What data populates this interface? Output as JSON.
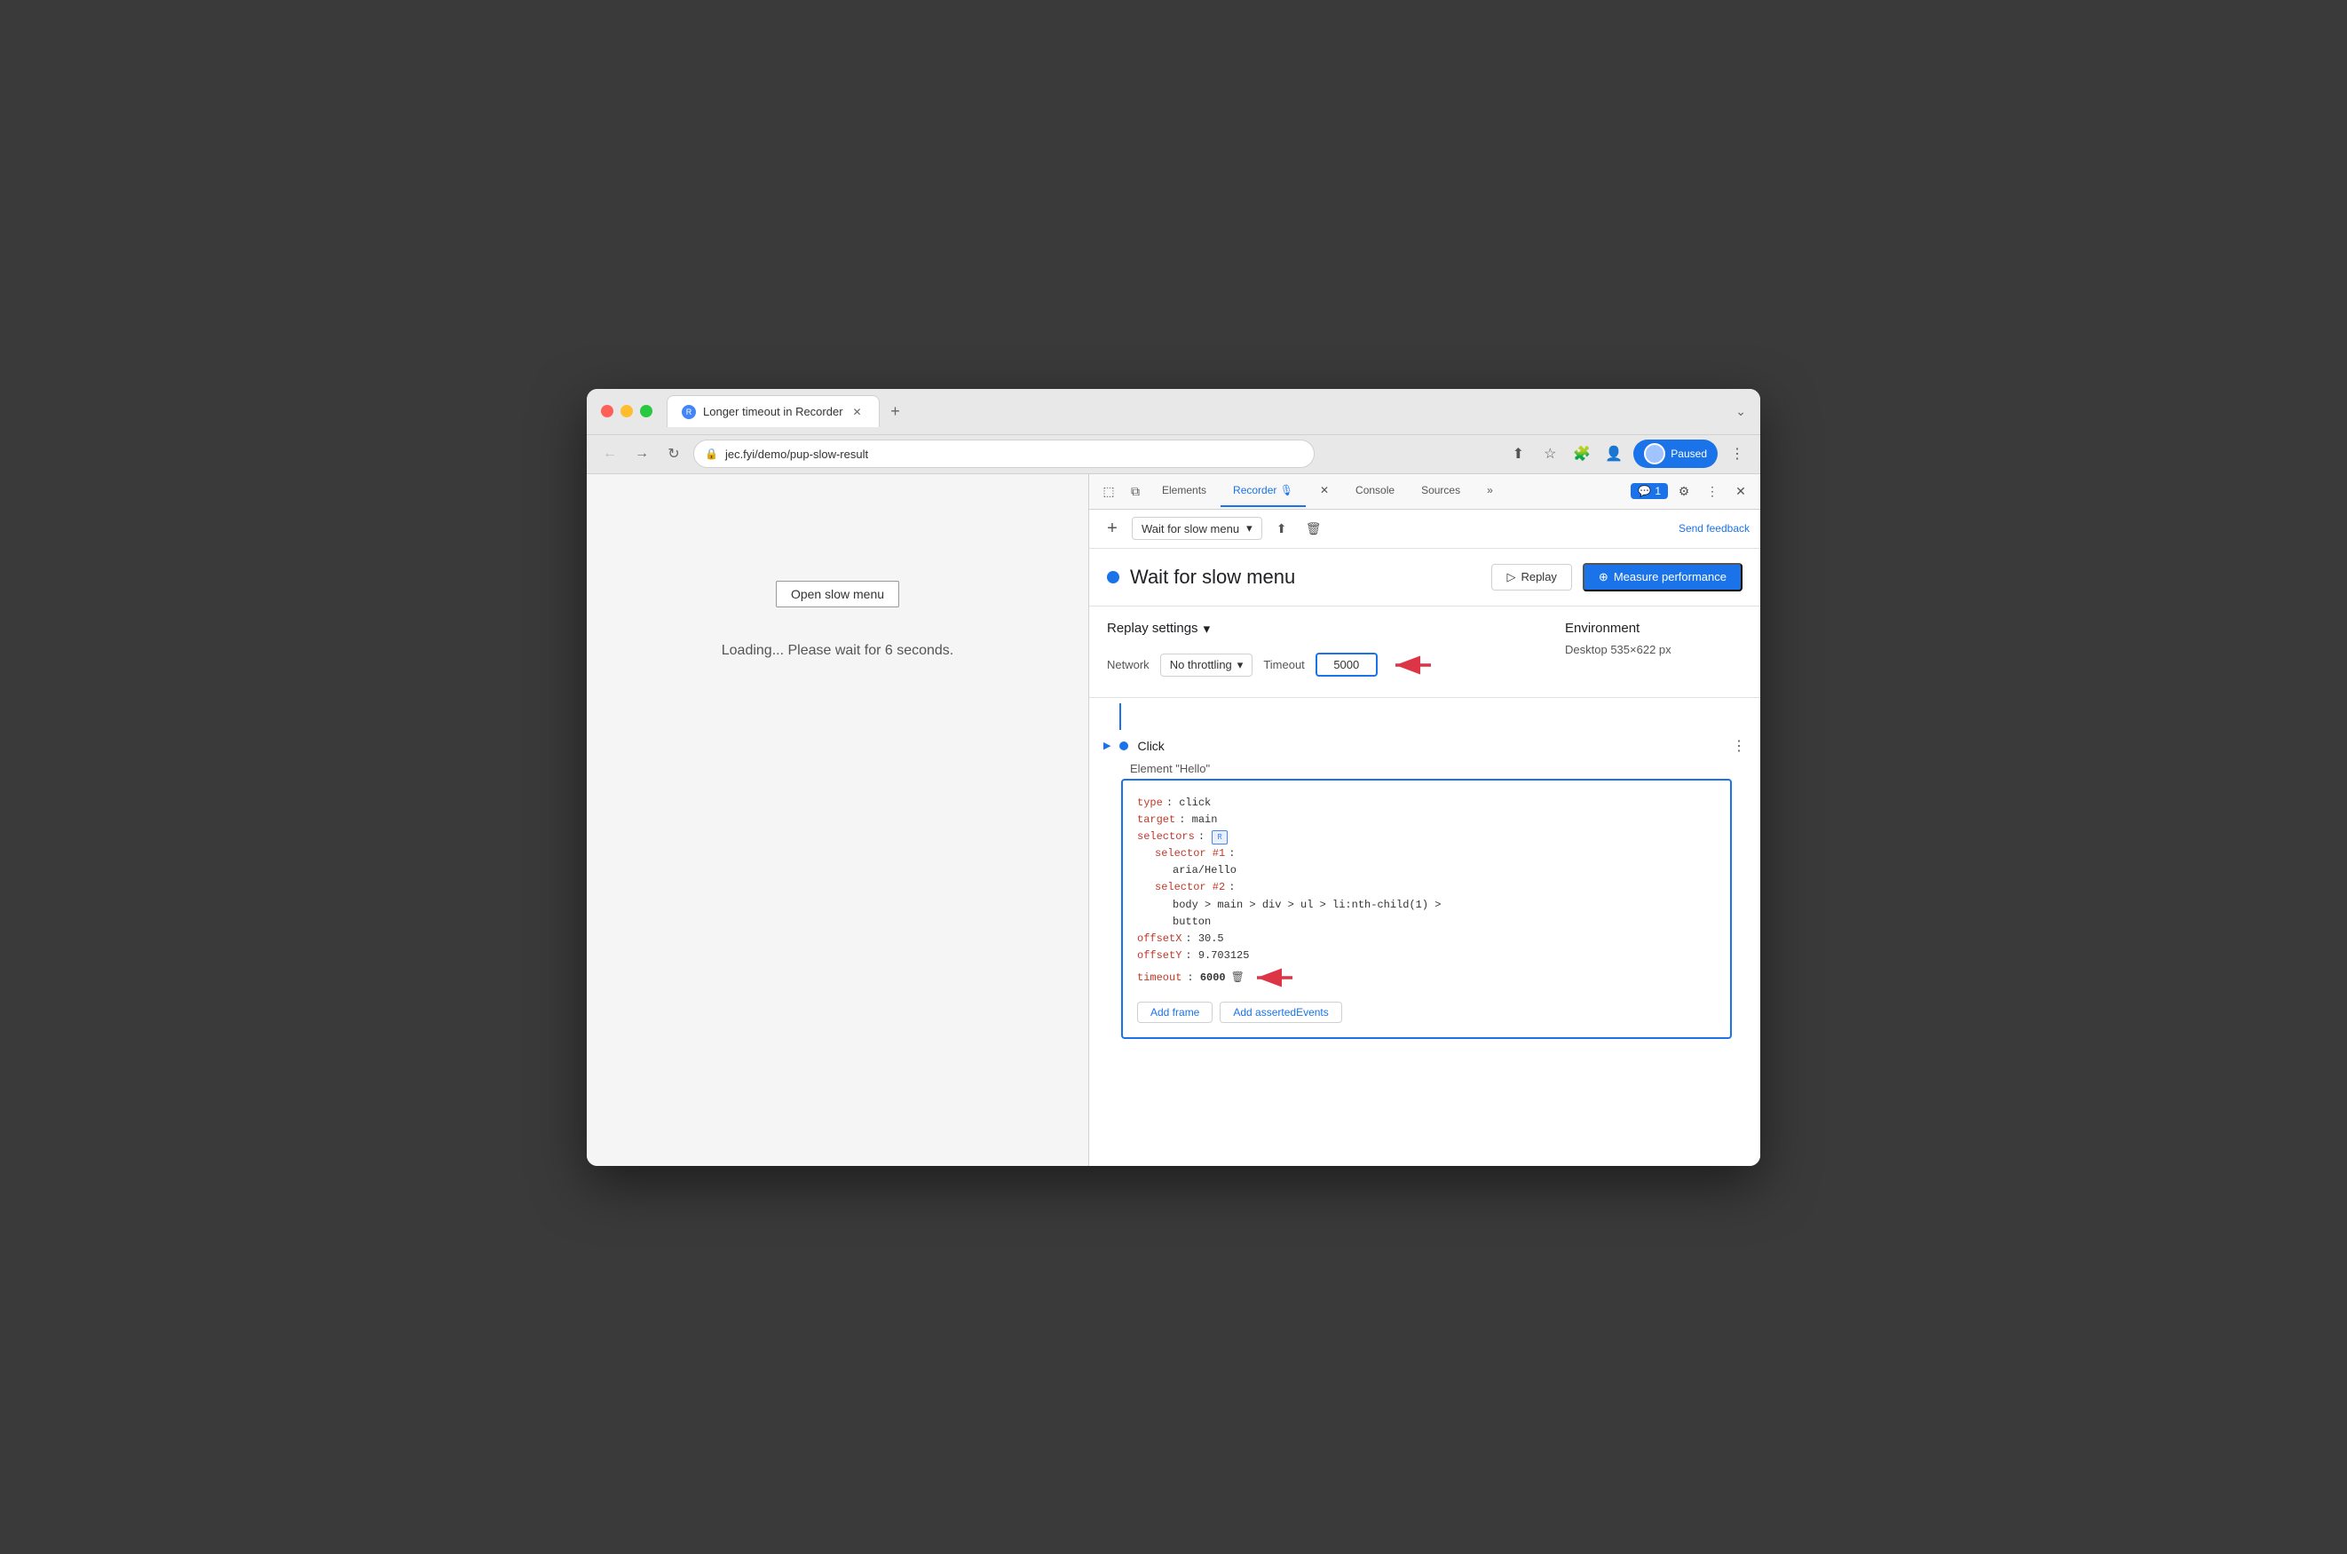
{
  "browser": {
    "tab_title": "Longer timeout in Recorder",
    "url": "jec.fyi/demo/pup-slow-result",
    "paused_label": "Paused"
  },
  "devtools": {
    "tabs": [
      "Elements",
      "Recorder",
      "Console",
      "Sources"
    ],
    "active_tab": "Recorder",
    "more_label": "»",
    "notification_count": "1",
    "send_feedback": "Send feedback"
  },
  "recorder": {
    "add_label": "+",
    "recording_name": "Wait for slow menu",
    "replay_label": "Replay",
    "measure_label": "Measure performance",
    "recording_title": "Wait for slow menu",
    "settings_title": "Replay settings",
    "network_label": "Network",
    "network_value": "No throttling",
    "timeout_label": "Timeout",
    "timeout_value": "5000",
    "env_title": "Environment",
    "env_value": "Desktop",
    "env_size": "535×622 px"
  },
  "step": {
    "name": "Click",
    "sub_label": "Element \"Hello\"",
    "type_key": "type",
    "type_val": "click",
    "target_key": "target",
    "target_val": "main",
    "selectors_key": "selectors",
    "selector1_key": "selector #1",
    "selector1_val": "aria/Hello",
    "selector2_key": "selector #2",
    "selector2_val1": "body > main > div > ul > li:nth-child(1) >",
    "selector2_val2": "button",
    "offsetX_key": "offsetX",
    "offsetX_val": "30.5",
    "offsetY_key": "offsetY",
    "offsetY_val": "9.703125",
    "timeout_key": "timeout",
    "timeout_val": "6000",
    "add_frame_label": "Add frame",
    "add_asserted_label": "Add assertedEvents"
  },
  "page": {
    "open_menu_label": "Open slow menu",
    "loading_text": "Loading... Please wait for 6 seconds."
  }
}
